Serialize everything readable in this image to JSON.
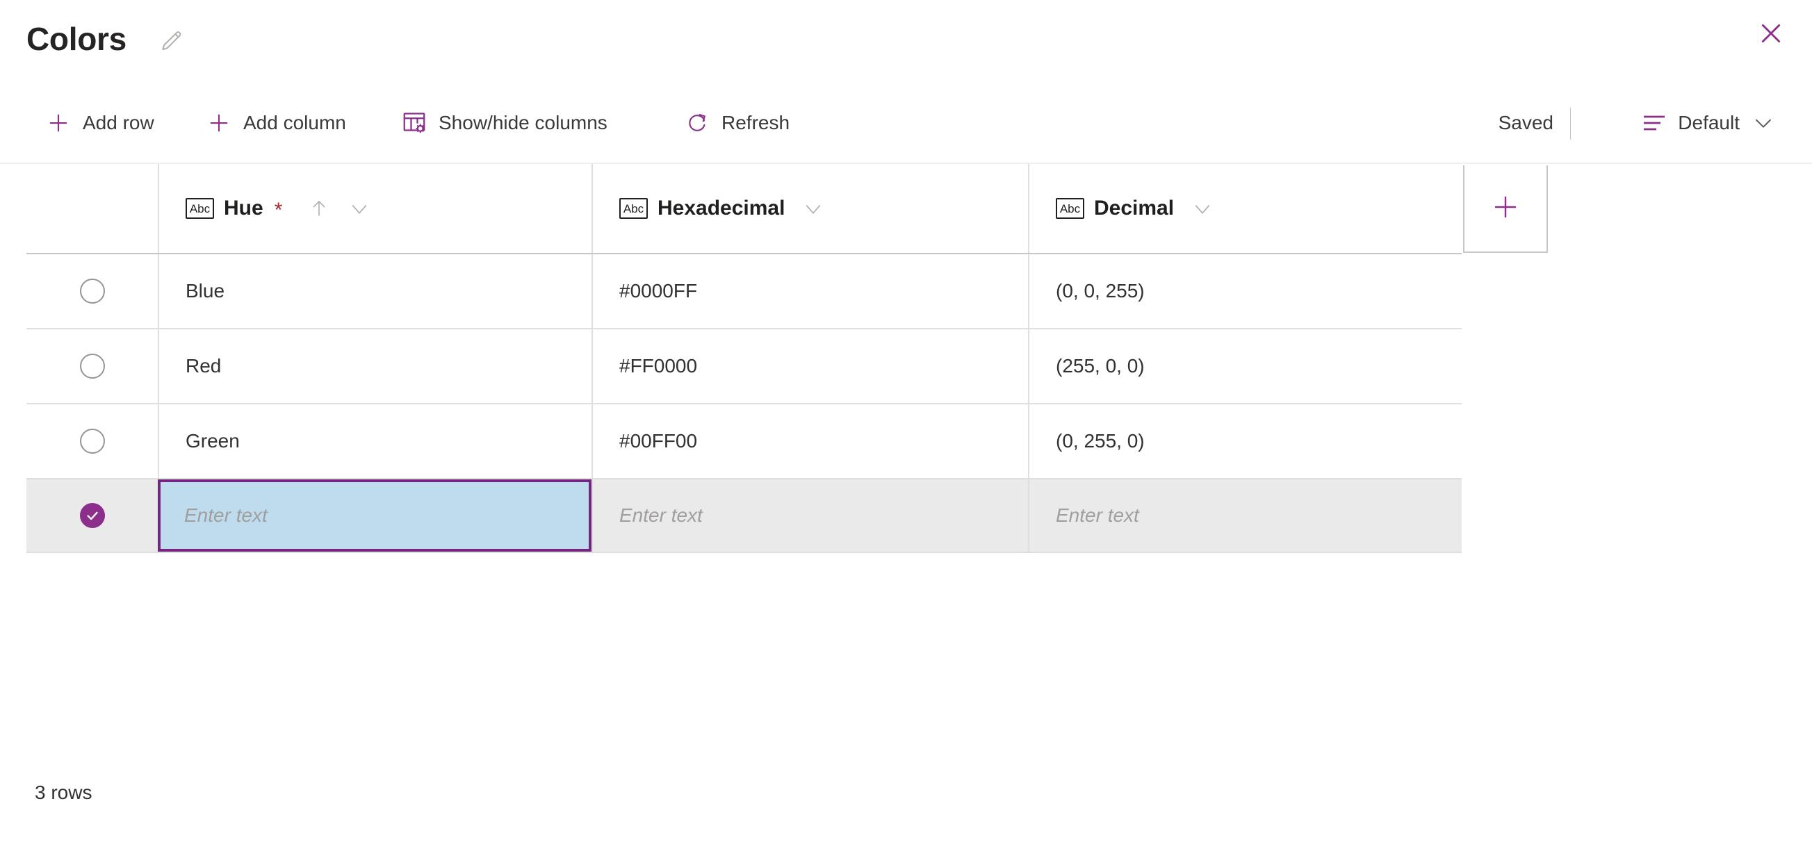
{
  "header": {
    "title": "Colors",
    "edit_icon": "pencil-icon",
    "close_icon": "close-icon"
  },
  "toolbar": {
    "add_row_label": "Add row",
    "add_column_label": "Add column",
    "show_hide_columns_label": "Show/hide columns",
    "refresh_label": "Refresh",
    "saved_status": "Saved",
    "view_label": "Default",
    "icons": {
      "add_row": "plus-icon",
      "add_column": "plus-icon",
      "show_hide_columns": "columns-settings-icon",
      "refresh": "refresh-icon",
      "view": "list-view-icon",
      "view_chevron": "chevron-down-icon"
    }
  },
  "grid": {
    "columns": [
      {
        "label": "Hue",
        "type_icon": "Abc",
        "required": true,
        "required_marker": "*",
        "sorted": "ascending"
      },
      {
        "label": "Hexadecimal",
        "type_icon": "Abc",
        "required": false,
        "required_marker": "",
        "sorted": "none"
      },
      {
        "label": "Decimal",
        "type_icon": "Abc",
        "required": false,
        "required_marker": "",
        "sorted": "none"
      }
    ],
    "add_column_button": "+",
    "rows": [
      {
        "selected": false,
        "cells": [
          "Blue",
          "#0000FF",
          "(0, 0, 255)"
        ]
      },
      {
        "selected": false,
        "cells": [
          "Red",
          "#FF0000",
          "(255, 0, 0)"
        ]
      },
      {
        "selected": false,
        "cells": [
          "Green",
          "#00FF00",
          "(0, 255, 0)"
        ]
      }
    ],
    "new_row": {
      "selected": true,
      "check_glyph": "✓",
      "cells": [
        {
          "value": "",
          "placeholder": "Enter text",
          "focused": true
        },
        {
          "value": "",
          "placeholder": "Enter text",
          "focused": false
        },
        {
          "value": "",
          "placeholder": "Enter text",
          "focused": false
        }
      ]
    }
  },
  "footer": {
    "row_count": "3 rows"
  },
  "colors": {
    "accent_purple": "#8c2e8c",
    "focus_border": "#73267f",
    "focus_fill": "#bedcee",
    "required_red": "#a4262c",
    "new_row_bg": "#ebeaea",
    "grid_line": "#e1dfdd"
  }
}
